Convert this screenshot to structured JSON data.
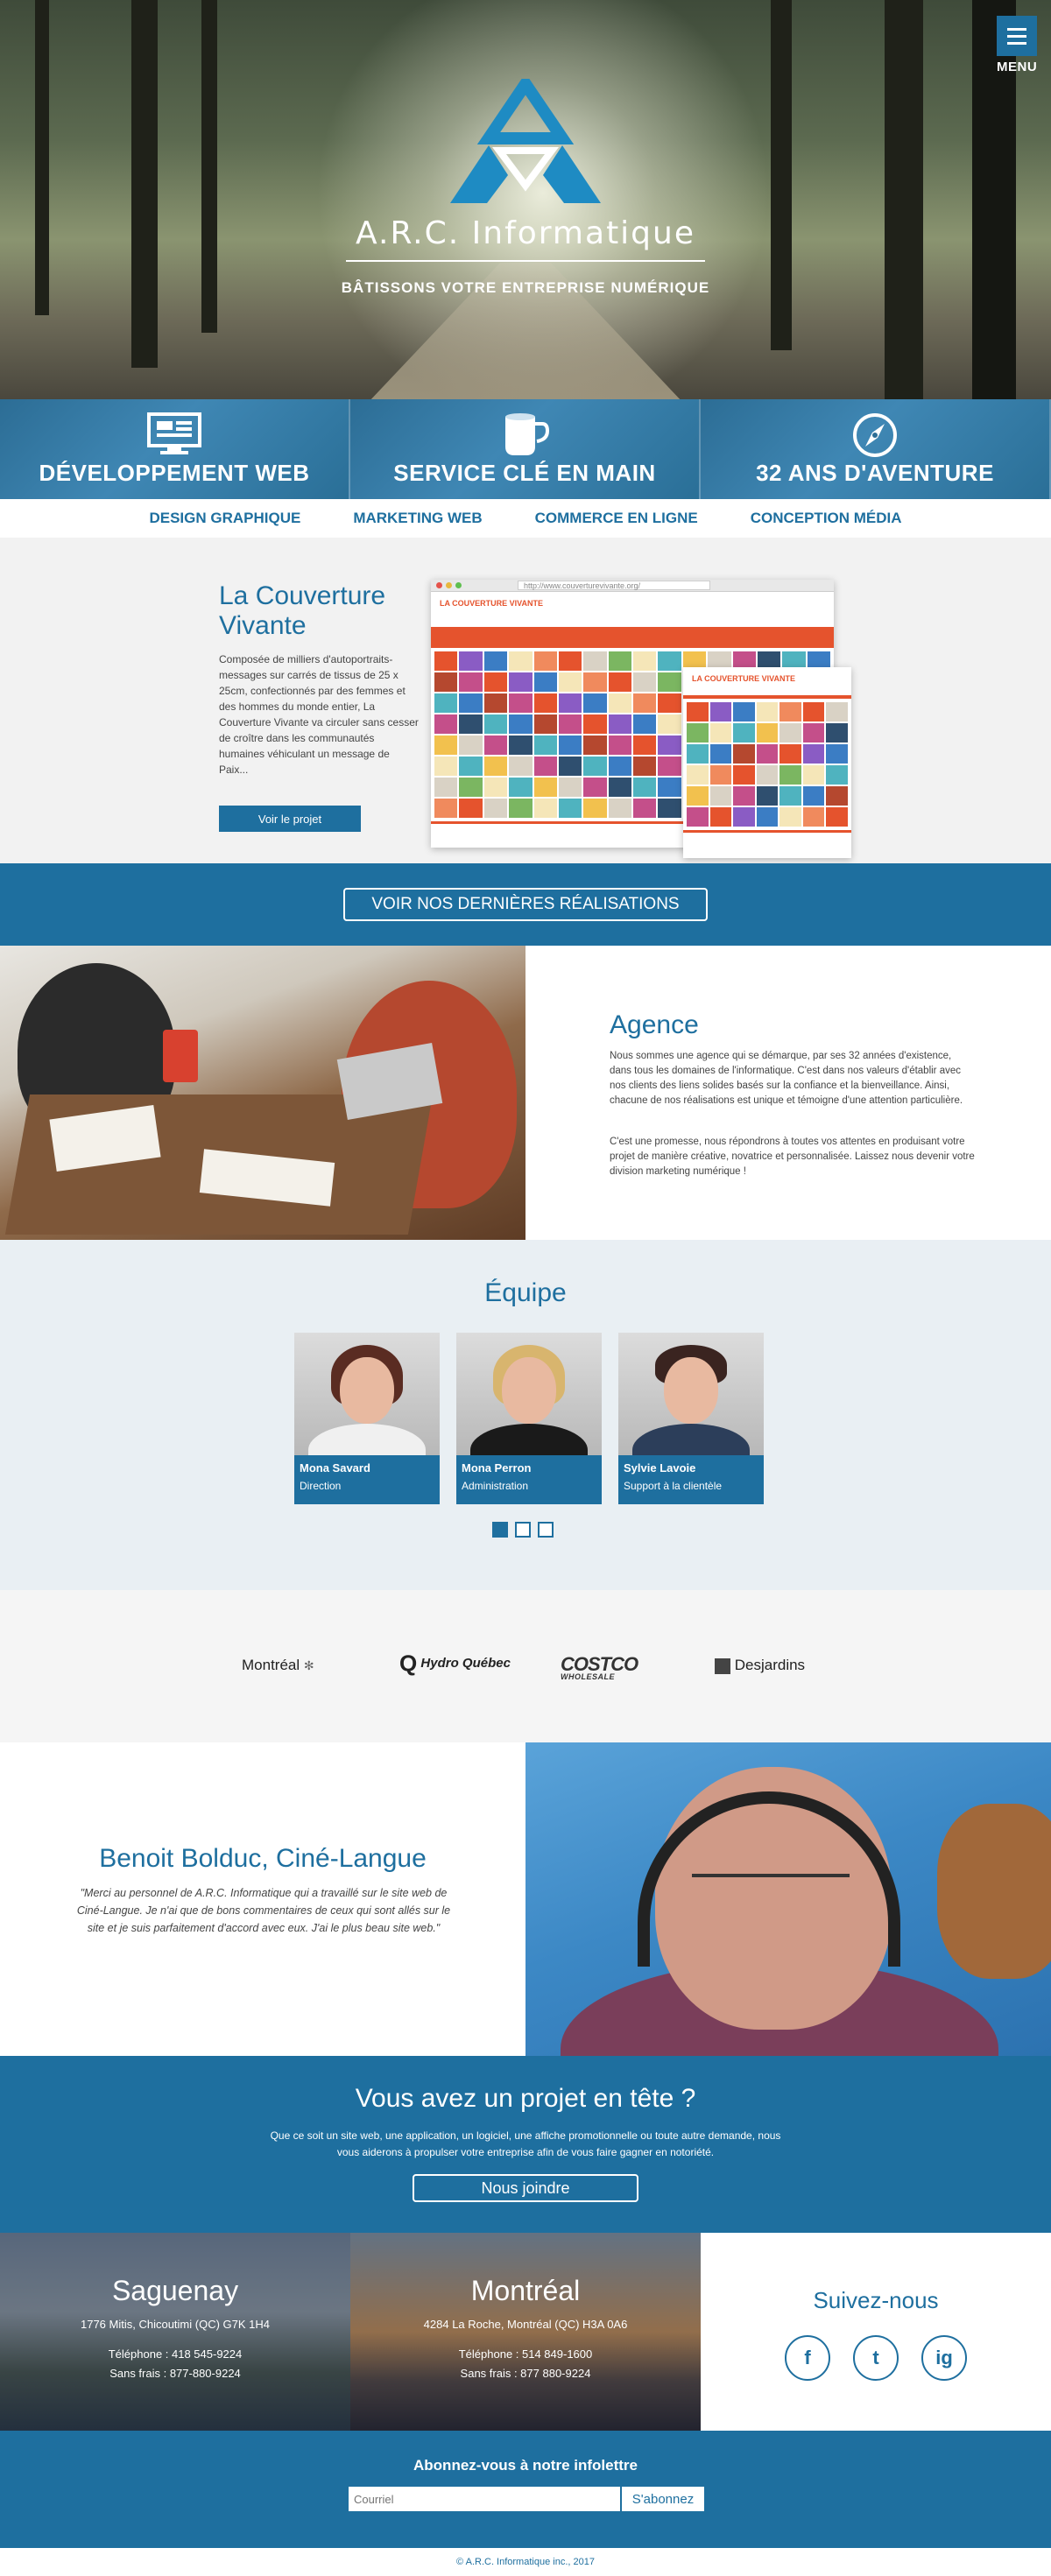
{
  "hero": {
    "menu_label": "MENU",
    "brand": "A.R.C. Informatique",
    "slogan": "BÂTISSONS VOTRE ENTREPRISE NUMÉRIQUE"
  },
  "services": [
    {
      "label": "DÉVELOPPEMENT WEB",
      "icon": "monitor-icon"
    },
    {
      "label": "SERVICE CLÉ EN MAIN",
      "icon": "mug-icon"
    },
    {
      "label": "32 ANS D'AVENTURE",
      "icon": "compass-icon"
    }
  ],
  "subnav": [
    "DESIGN GRAPHIQUE",
    "MARKETING WEB",
    "COMMERCE EN LIGNE",
    "CONCEPTION MÉDIA"
  ],
  "project": {
    "title": "La Couverture Vivante",
    "description": "Composée de milliers d'autoportraits-messages sur carrés de tissus de 25 x 25cm, confectionnés par des femmes et des hommes du monde entier, La Couverture Vivante va circuler sans cesser de croître dans les communautés humaines véhiculant un message de Paix...",
    "button": "Voir le projet",
    "mock_url": "http://www.couverturevivante.org/",
    "mock_logo": "LA COUVERTURE VIVANTE"
  },
  "realisations_button": "VOIR NOS DERNIÈRES RÉALISATIONS",
  "agence": {
    "title": "Agence",
    "p1": "Nous sommes une agence qui se démarque, par ses 32 années d'existence, dans tous les domaines de l'informatique. C'est dans nos valeurs d'établir avec nos clients des liens solides basés sur la confiance et la bienveillance. Ainsi, chacune de nos réalisations est unique et témoigne d'une attention particulière.",
    "p2": "C'est une promesse, nous répondrons à toutes vos attentes en produisant votre projet de manière créative, novatrice et personnalisée. Laissez nous devenir votre division marketing numérique !"
  },
  "equipe": {
    "title": "Équipe",
    "members": [
      {
        "name": "Mona Savard",
        "role": "Direction"
      },
      {
        "name": "Mona Perron",
        "role": "Administration"
      },
      {
        "name": "Sylvie Lavoie",
        "role": "Support à la clientèle"
      }
    ]
  },
  "partners": [
    "Montréal",
    "Hydro Québec",
    "COSTCO",
    "WHOLESALE",
    "Desjardins"
  ],
  "temoignage": {
    "title": "Benoit Bolduc, Ciné-Langue",
    "quote": "\"Merci au personnel de A.R.C. Informatique qui a travaillé sur le site web de Ciné-Langue. Je n'ai que de bons commentaires de ceux qui sont allés sur le site et je suis parfaitement d'accord avec eux. J'ai le plus beau site web.\""
  },
  "cta": {
    "title": "Vous avez un projet en tête ?",
    "text": "Que ce soit un site web, une application, un logiciel, une affiche promotionnelle ou toute autre demande, nous vous aiderons à propulser votre entreprise afin de vous faire gagner en notoriété.",
    "button": "Nous joindre"
  },
  "offices": [
    {
      "city": "Saguenay",
      "address": "1776 Mitis, Chicoutimi (QC) G7K 1H4",
      "phone": "Téléphone : 418 545-9224",
      "tollfree": "Sans frais : 877-880-9224"
    },
    {
      "city": "Montréal",
      "address": "4284 La Roche, Montréal (QC) H3A 0A6",
      "phone": "Téléphone : 514 849-1600",
      "tollfree": "Sans frais : 877 880-9224"
    }
  ],
  "social": {
    "title": "Suivez-nous",
    "networks": [
      "f",
      "t",
      "ig"
    ]
  },
  "newsletter": {
    "title": "Abonnez-vous à notre infolettre",
    "placeholder": "Courriel",
    "button": "S'abonnez"
  },
  "footer": "© A.R.C. Informatique inc., 2017",
  "colors": {
    "brand": "#1e6f9f",
    "accent": "#e5532d"
  }
}
